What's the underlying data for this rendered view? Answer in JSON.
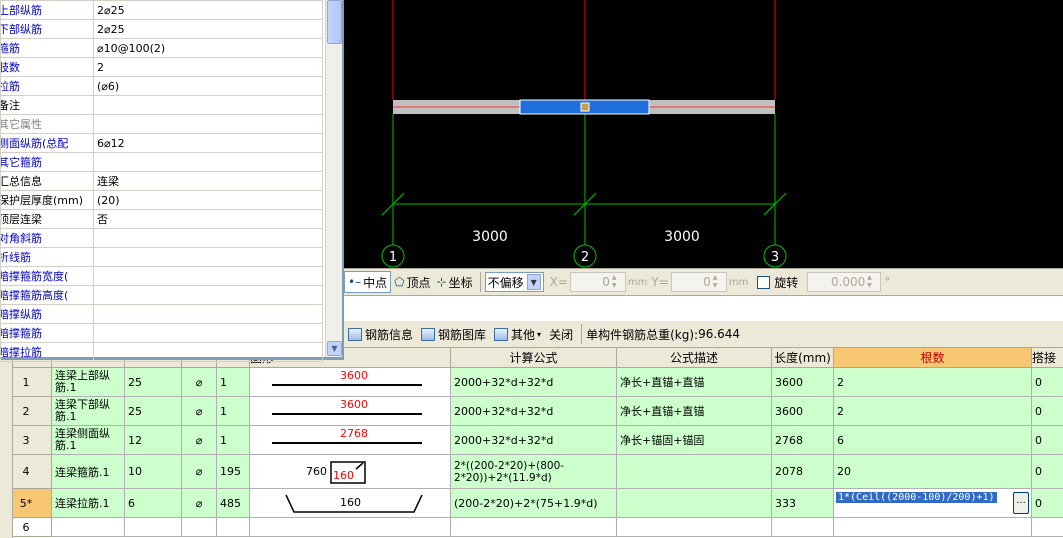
{
  "properties": [
    {
      "name": "上部纵筋",
      "value": "2⌀25",
      "style": "blue"
    },
    {
      "name": "下部纵筋",
      "value": "2⌀25",
      "style": "blue"
    },
    {
      "name": "箍筋",
      "value": "⌀10@100(2)",
      "style": "blue"
    },
    {
      "name": "肢数",
      "value": "2",
      "style": "blue"
    },
    {
      "name": "拉筋",
      "value": "(⌀6)",
      "style": "blue"
    },
    {
      "name": "备注",
      "value": "",
      "style": "normal"
    },
    {
      "name": "其它属性",
      "value": "",
      "style": "gray"
    },
    {
      "name": "侧面纵筋(总配",
      "value": "6⌀12",
      "style": "blue"
    },
    {
      "name": "其它箍筋",
      "value": "",
      "style": "blue"
    },
    {
      "name": "汇总信息",
      "value": "连梁",
      "style": "normal"
    },
    {
      "name": "保护层厚度(mm)",
      "value": "(20)",
      "style": "normal"
    },
    {
      "name": "顶层连梁",
      "value": "否",
      "style": "normal"
    },
    {
      "name": "对角斜筋",
      "value": "",
      "style": "blue"
    },
    {
      "name": "折线筋",
      "value": "",
      "style": "blue"
    },
    {
      "name": "暗撑箍筋宽度(",
      "value": "",
      "style": "blue"
    },
    {
      "name": "暗撑箍筋高度(",
      "value": "",
      "style": "blue"
    },
    {
      "name": "暗撑纵筋",
      "value": "",
      "style": "blue"
    },
    {
      "name": "暗撑箍筋",
      "value": "",
      "style": "blue"
    },
    {
      "name": "暗撑拉筋",
      "value": "",
      "style": "blue"
    }
  ],
  "cad": {
    "dimensions": [
      "3000",
      "3000"
    ],
    "axes": [
      "1",
      "2",
      "3"
    ]
  },
  "snapbar": {
    "midpoint": "中点",
    "vertex": "顶点",
    "coordinate": "坐标",
    "offset_mode": "不偏移",
    "x_label": "X=",
    "x_value": "0",
    "y_label": "Y=",
    "y_value": "0",
    "unit": "mm",
    "rotate": "旋转",
    "rotate_value": "0.000",
    "degree": "°"
  },
  "rebar_toolbar": {
    "info": "钢筋信息",
    "library": "钢筋图库",
    "other": "其他",
    "close": "关闭",
    "total_label": "单构件钢筋总重(kg):",
    "total_value": "96.644"
  },
  "grid": {
    "headers": [
      "",
      "",
      "",
      "",
      "",
      "图形",
      "计算公式",
      "公式描述",
      "长度(mm)",
      "根数",
      "搭接"
    ],
    "rows": [
      {
        "no": "1",
        "name": "连梁上部纵筋.1",
        "dia": "25",
        "grade": "⌀",
        "shape_no": "1",
        "shape_value": "3600",
        "formula": "2000+32*d+32*d",
        "desc": "净长+直锚+直锚",
        "length": "3600",
        "count": "2",
        "lap": "0"
      },
      {
        "no": "2",
        "name": "连梁下部纵筋.1",
        "dia": "25",
        "grade": "⌀",
        "shape_no": "1",
        "shape_value": "3600",
        "formula": "2000+32*d+32*d",
        "desc": "净长+直锚+直锚",
        "length": "3600",
        "count": "2",
        "lap": "0"
      },
      {
        "no": "3",
        "name": "连梁侧面纵筋.1",
        "dia": "12",
        "grade": "⌀",
        "shape_no": "1",
        "shape_value": "2768",
        "formula": "2000+32*d+32*d",
        "desc": "净长+锚固+锚固",
        "length": "2768",
        "count": "6",
        "lap": "0"
      },
      {
        "no": "4",
        "name": "连梁箍筋.1",
        "dia": "10",
        "grade": "⌀",
        "shape_no": "195",
        "shape_value": "160",
        "shape_value2": "760",
        "formula": "2*((200-2*20)+(800-2*20))+2*(11.9*d)",
        "desc": "",
        "length": "2078",
        "count": "20",
        "lap": "0"
      },
      {
        "no": "5*",
        "name": "连梁拉筋.1",
        "dia": "6",
        "grade": "⌀",
        "shape_no": "485",
        "shape_value": "160",
        "formula": "(200-2*20)+2*(75+1.9*d)",
        "desc": "",
        "length": "333",
        "count": "1*(Ceil((2000-100)/200)+1)",
        "lap": "0"
      },
      {
        "no": "6",
        "name": "",
        "dia": "",
        "grade": "",
        "shape_no": "",
        "shape_value": "",
        "formula": "",
        "desc": "",
        "length": "",
        "count": "",
        "lap": ""
      }
    ]
  },
  "colors": {
    "cad_background": "#000000",
    "beam_selected": "#1e6fdc",
    "axis_line": "#ff0000",
    "grid_line": "#00c000",
    "row_green": "#ccffcc",
    "header_highlight": "#f7c773"
  }
}
